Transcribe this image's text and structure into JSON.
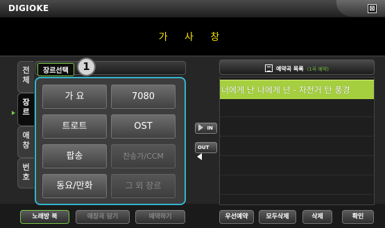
{
  "window": {
    "title": "DIGIOKE",
    "close_icon": "⊠"
  },
  "lyrics": {
    "text": "가 사 창"
  },
  "side_tabs": [
    {
      "label": "전체"
    },
    {
      "label": "장르",
      "active": true
    },
    {
      "label": "애창"
    },
    {
      "label": "번호"
    }
  ],
  "genre_panel": {
    "tab_label": "장르선택",
    "callout": "1",
    "buttons": [
      {
        "label": "가 요",
        "enabled": true
      },
      {
        "label": "7080",
        "enabled": true
      },
      {
        "label": "트로트",
        "enabled": true
      },
      {
        "label": "OST",
        "enabled": true
      },
      {
        "label": "팝송",
        "enabled": true
      },
      {
        "label": "찬송가/CCM",
        "enabled": false
      },
      {
        "label": "동요/만화",
        "enabled": true
      },
      {
        "label": "그 외 장르",
        "enabled": false
      }
    ]
  },
  "transfer": {
    "in_label": "IN",
    "out_label": "OUT"
  },
  "queue": {
    "title": "예약곡 목록",
    "count": "(1곡 예약)",
    "items": [
      "너에게 난 나에게 넌 - 자전거 탄 풍경"
    ]
  },
  "bottom_left": [
    {
      "label": "노래방 북",
      "active": true
    },
    {
      "label": "애창곡 담기",
      "enabled": false
    },
    {
      "label": "예약하기",
      "enabled": false
    }
  ],
  "bottom_right": [
    {
      "label": "우선예약"
    },
    {
      "label": "모두삭제"
    },
    {
      "label": "삭제"
    },
    {
      "label": "확인"
    }
  ]
}
